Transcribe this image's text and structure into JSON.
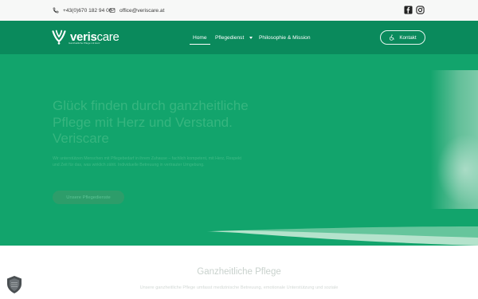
{
  "topbar": {
    "phone": "+43(0)670 182 94 00",
    "email": "office@veriscare.at",
    "icons": [
      "phone-icon",
      "mail-icon",
      "facebook-icon",
      "instagram-icon"
    ]
  },
  "header": {
    "logo_bold": "veris",
    "logo_light": "care",
    "logo_tagline": "Ganzheitliche Pflege mit Herz",
    "nav": {
      "home": "Home",
      "pflegedienst": "Pflegedienst",
      "philosophie": "Philosophie & Mission"
    },
    "contact_button": "Kontakt"
  },
  "hero": {
    "title": "Glück finden durch ganzheitliche Pflege mit Herz und Verstand. Veriscare",
    "subtitle": "Wir unterstützen Menschen mit Pflegebedarf in ihrem Zuhause – fachlich kompetent, mit Herz, Respekt und Zeit für das, was wirklich zählt. Individuelle Betreuung in vertrauter Umgebung.",
    "button": "Unsere Pflegedienste"
  },
  "section": {
    "title": "Ganzheitliche Pflege",
    "text": "Unsere ganzheitliche Pflege umfasst medizinische Betreuung, emotionale Unterstützung und soziale"
  },
  "colors": {
    "header_bg": "#0a8a5c",
    "hero_bg": "#12a46c",
    "topbar_bg": "#f7f8f7"
  }
}
